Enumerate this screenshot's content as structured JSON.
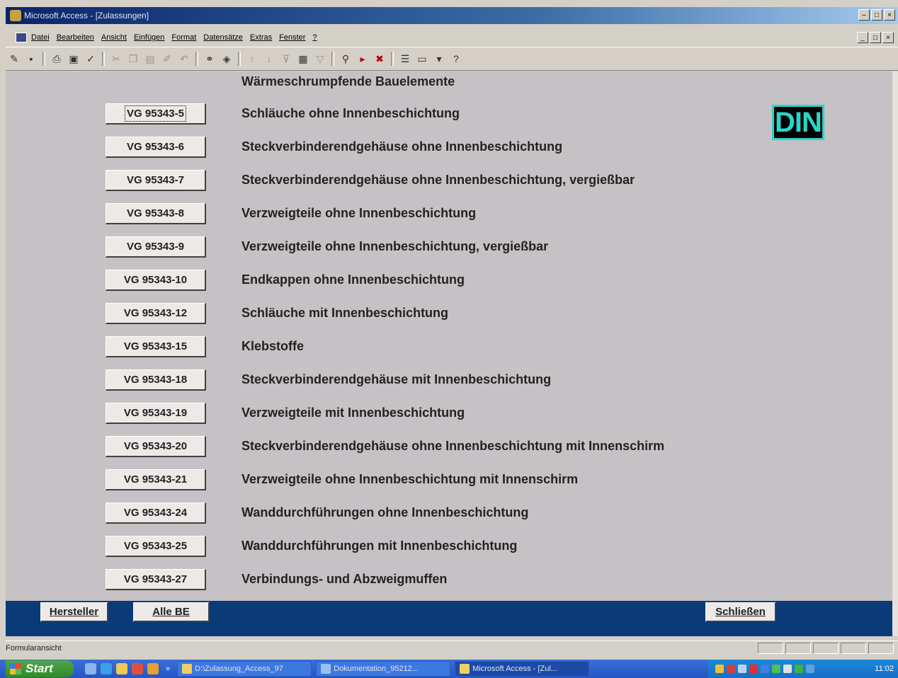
{
  "window": {
    "title": "Microsoft Access - [Zulassungen]",
    "controls": [
      "–",
      "□",
      "×"
    ]
  },
  "menu": {
    "items": [
      "Datei",
      "Bearbeiten",
      "Ansicht",
      "Einfügen",
      "Format",
      "Datensätze",
      "Extras",
      "Fenster",
      "?"
    ],
    "mdi_controls": [
      "_",
      "□",
      "×"
    ]
  },
  "toolbar": {
    "icons": [
      "design-view-icon",
      "save-icon",
      "print-icon",
      "print-preview-icon",
      "spelling-icon",
      "cut-icon",
      "copy-icon",
      "paste-icon",
      "format-painter-icon",
      "undo-icon",
      "insert-hyperlink-icon",
      "web-icon",
      "sort-ascending-icon",
      "sort-descending-icon",
      "filter-selection-icon",
      "filter-form-icon",
      "apply-filter-icon",
      "find-icon",
      "new-record-icon",
      "delete-record-icon",
      "properties-icon",
      "database-window-icon",
      "new-object-icon",
      "help-icon"
    ]
  },
  "form": {
    "heading": "Wärmeschrumpfende Bauelemente",
    "logo_text": "DIN",
    "rows": [
      {
        "code": "VG 95343-5",
        "label": "Schläuche ohne Innenbeschichtung"
      },
      {
        "code": "VG 95343-6",
        "label": "Steckverbinderendgehäuse ohne Innenbeschichtung"
      },
      {
        "code": "VG 95343-7",
        "label": "Steckverbinderendgehäuse ohne Innenbeschichtung, vergießbar"
      },
      {
        "code": "VG 95343-8",
        "label": "Verzweigteile ohne Innenbeschichtung"
      },
      {
        "code": "VG 95343-9",
        "label": "Verzweigteile ohne Innenbeschichtung, vergießbar"
      },
      {
        "code": "VG 95343-10",
        "label": "Endkappen ohne Innenbeschichtung"
      },
      {
        "code": "VG 95343-12",
        "label": "Schläuche mit Innenbeschichtung"
      },
      {
        "code": "VG 95343-15",
        "label": "Klebstoffe"
      },
      {
        "code": "VG 95343-18",
        "label": "Steckverbinderendgehäuse mit Innenbeschichtung"
      },
      {
        "code": "VG 95343-19",
        "label": "Verzweigteile mit Innenbeschichtung"
      },
      {
        "code": "VG 95343-20",
        "label": "Steckverbinderendgehäuse ohne Innenbeschichtung mit Innenschirm"
      },
      {
        "code": "VG 95343-21",
        "label": "Verzweigteile ohne Innenbeschichtung mit Innenschirm"
      },
      {
        "code": "VG 95343-24",
        "label": "Wanddurchführungen ohne Innenbeschichtung"
      },
      {
        "code": "VG 95343-25",
        "label": "Wanddurchführungen mit Innenbeschichtung"
      },
      {
        "code": "VG 95343-27",
        "label": "Verbindungs- und Abzweigmuffen"
      }
    ]
  },
  "footer": {
    "hersteller": "Hersteller",
    "alle_be": "Alle BE",
    "schliessen": "Schließen"
  },
  "status": {
    "text": "Formularansicht"
  },
  "taskbar": {
    "start": "Start",
    "chevron": "»",
    "tasks": [
      "D:\\Zulassung_Access_97",
      "Dokumentation_95212...",
      "Microsoft Access - [Zul..."
    ],
    "clock": "11:02"
  },
  "colors": {
    "form_bg": "#c5c1c4",
    "footer_bar": "#0a3a78",
    "din_accent": "#2bd4c8"
  }
}
